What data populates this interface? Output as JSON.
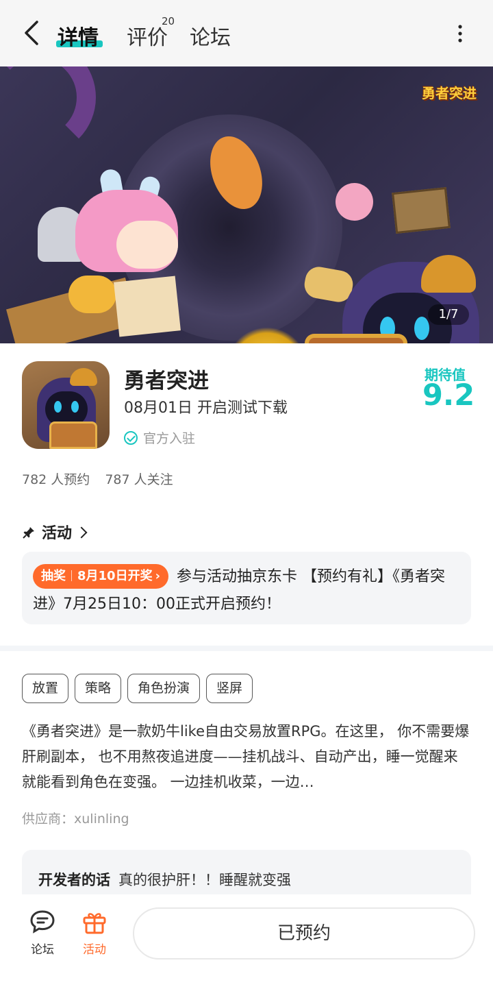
{
  "header": {
    "tabs": [
      {
        "label": "详情"
      },
      {
        "label": "评价",
        "badge": "20"
      },
      {
        "label": "论坛"
      }
    ]
  },
  "banner": {
    "logo_text": "勇者突进",
    "pager": "1/7"
  },
  "game": {
    "title": "勇者突进",
    "subtitle": "08月01日 开启测试下载",
    "official": "官方入驻",
    "score_label": "期待值",
    "score_value": "9.2",
    "reserve_count": "782 人预约",
    "follow_count": "787 人关注"
  },
  "activity": {
    "heading": "活动",
    "tag_type": "抽奖",
    "tag_date": "8月10日开奖",
    "text": "参与活动抽京东卡 【预约有礼】《勇者突进》7月25日10：00正式开启预约！"
  },
  "tags": [
    "放置",
    "策略",
    "角色扮演",
    "竖屏"
  ],
  "description": "《勇者突进》是一款奶牛like自由交易放置RPG。在这里， 你不需要爆肝刷副本， 也不用熬夜追进度——挂机战斗、自动产出，睡一觉醒来就能看到角色在变强。 一边挂机收菜，一边…",
  "supplier": "供应商：xulinling",
  "developer": {
    "label": "开发者的话",
    "text": "真的很护肝！！睡醒就变强"
  },
  "bottom": {
    "forum_label": "论坛",
    "activity_label": "活动",
    "reserved_label": "已预约"
  },
  "colors": {
    "accent": "#19c6c0",
    "orange": "#ff6a2b"
  },
  "icons": [
    "back-arrow-icon",
    "more-vertical-icon",
    "check-circle-icon",
    "pin-icon",
    "chevron-right-icon",
    "forum-chat-icon",
    "gift-icon"
  ]
}
